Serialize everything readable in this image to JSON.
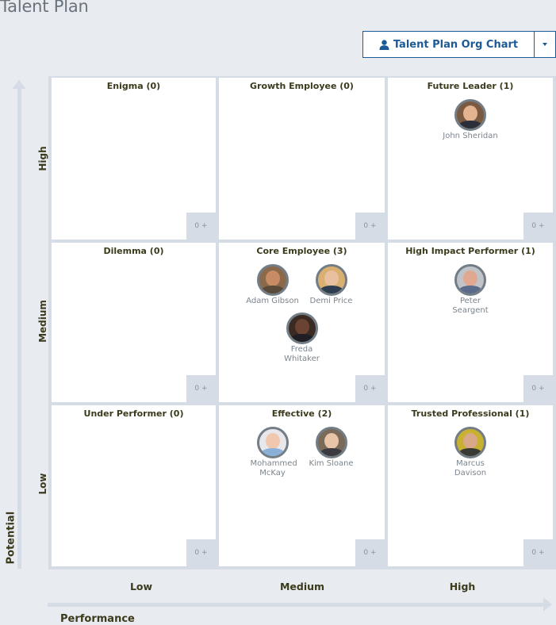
{
  "page": {
    "title": "Talent Plan"
  },
  "toolbar": {
    "org_chart_button_label": "Talent Plan Org Chart",
    "org_chart_button_icon": "user-icon",
    "dropdown_icon": "caret-down-icon",
    "accent_color": "#1c5a96"
  },
  "axes": {
    "y_title": "Potential",
    "x_title": "Performance",
    "y_levels": [
      "High",
      "Medium",
      "Low"
    ],
    "x_levels": [
      "Low",
      "Medium",
      "High"
    ]
  },
  "grid": {
    "cells": [
      {
        "title": "Enigma (0)",
        "potential": "High",
        "performance": "Low",
        "badge": "0 +",
        "people": []
      },
      {
        "title": "Growth Employee (0)",
        "potential": "High",
        "performance": "Medium",
        "badge": "0 +",
        "people": []
      },
      {
        "title": "Future Leader (1)",
        "potential": "High",
        "performance": "High",
        "badge": "0 +",
        "people": [
          {
            "name": "John Sheridan"
          }
        ]
      },
      {
        "title": "Dilemma (0)",
        "potential": "Medium",
        "performance": "Low",
        "badge": "0 +",
        "people": []
      },
      {
        "title": "Core Employee (3)",
        "potential": "Medium",
        "performance": "Medium",
        "badge": "0 +",
        "people": [
          {
            "name": "Adam Gibson"
          },
          {
            "name": "Demi Price"
          },
          {
            "name": "Freda Whitaker"
          }
        ]
      },
      {
        "title": "High Impact Performer (1)",
        "potential": "Medium",
        "performance": "High",
        "badge": "0 +",
        "people": [
          {
            "name": "Peter Seargent"
          }
        ]
      },
      {
        "title": "Under Performer (0)",
        "potential": "Low",
        "performance": "Low",
        "badge": "0 +",
        "people": []
      },
      {
        "title": "Effective (2)",
        "potential": "Low",
        "performance": "Medium",
        "badge": "0 +",
        "people": [
          {
            "name": "Mohammed McKay"
          },
          {
            "name": "Kim Sloane"
          }
        ]
      },
      {
        "title": "Trusted Professional (1)",
        "potential": "Low",
        "performance": "High",
        "badge": "0 +",
        "people": [
          {
            "name": "Marcus Davison"
          }
        ]
      }
    ]
  }
}
